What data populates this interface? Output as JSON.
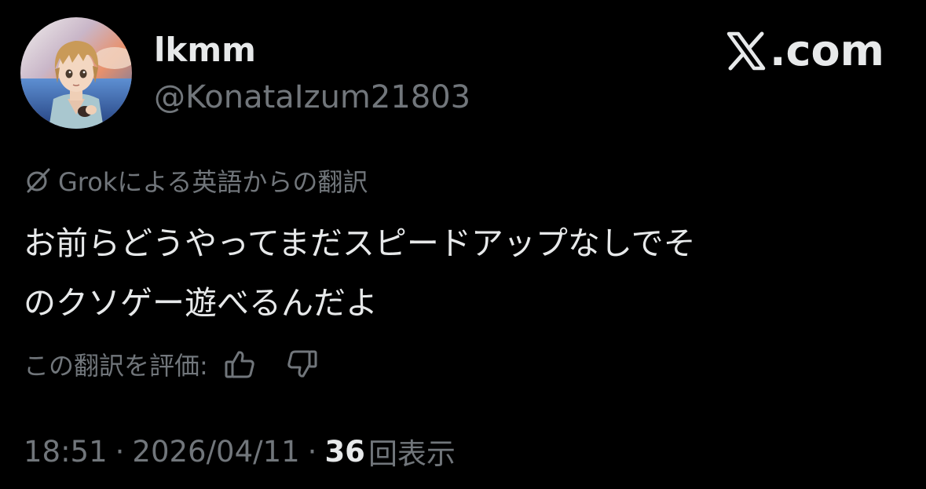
{
  "user": {
    "display_name": "lkmm",
    "handle": "@KonataIzum21803",
    "avatar_icon": "anime-character-avatar"
  },
  "brand": {
    "logo_icon": "x-logo-icon",
    "text": ".com"
  },
  "translation": {
    "icon": "grok-icon",
    "label": "Grokによる英語からの翻訳"
  },
  "tweet": {
    "lines": [
      "お前らどうやってまだスピードアップなしでそ",
      "のクソゲー遊べるんだよ"
    ]
  },
  "rating": {
    "label": "この翻訳を評価:",
    "up_icon": "thumbs-up-icon",
    "down_icon": "thumbs-down-icon"
  },
  "meta": {
    "time": "18:51",
    "separator": "·",
    "date": "2026/04/11",
    "views_count": "36",
    "views_label": "回表示"
  },
  "colors": {
    "background": "#000000",
    "primary_text": "#e7e9ea",
    "secondary_text": "#71767b"
  }
}
